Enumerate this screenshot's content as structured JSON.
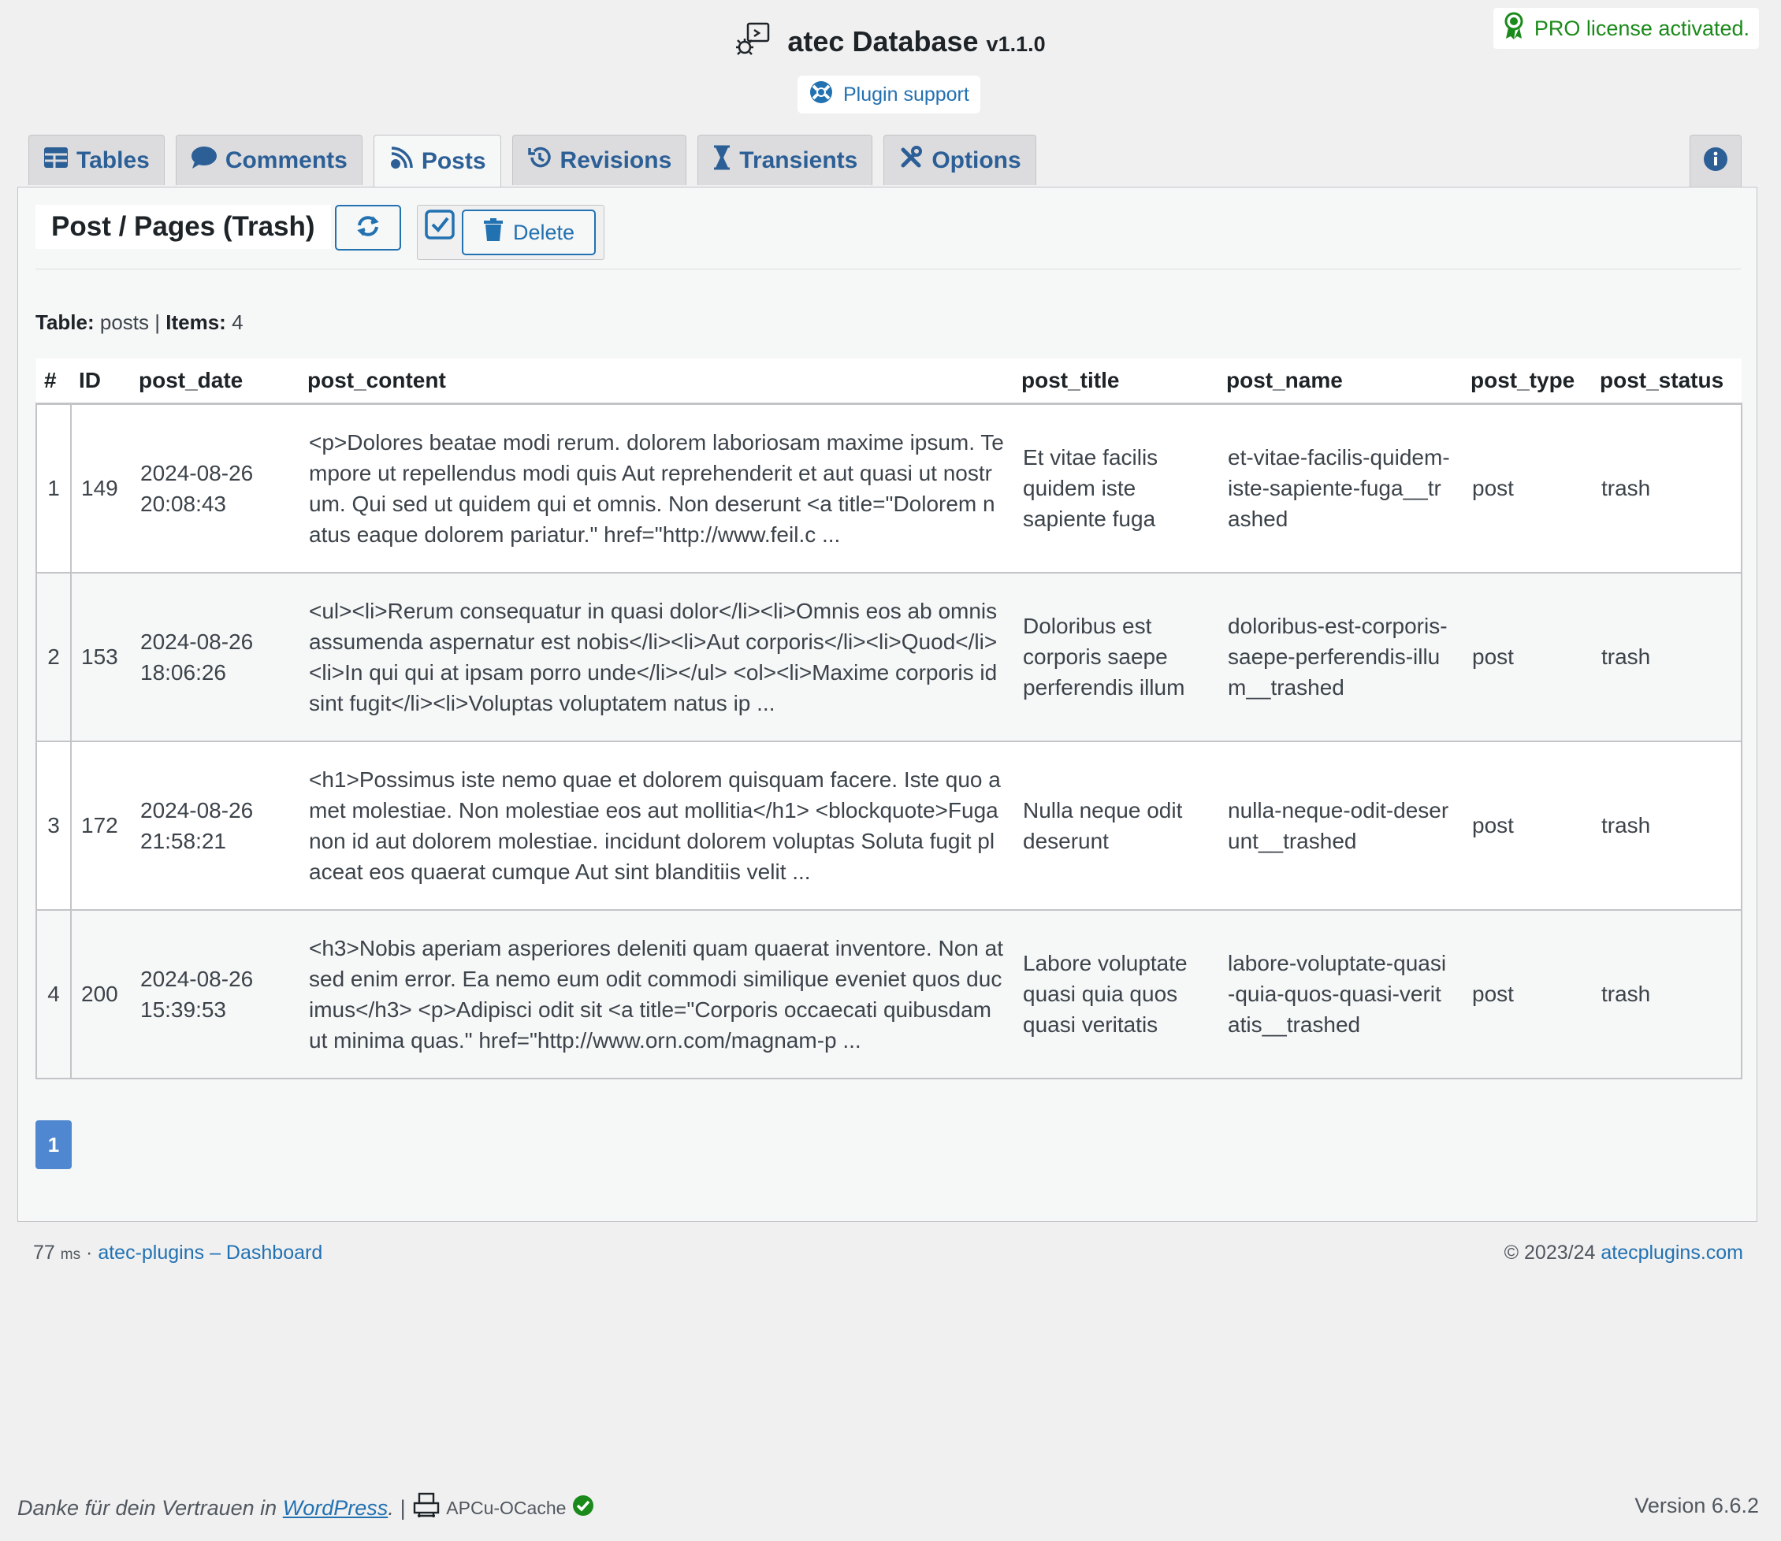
{
  "app": {
    "name": "atec Database",
    "version": "v1.1.0",
    "support_label": "Plugin support",
    "license_text": "PRO license activated."
  },
  "tabs": [
    {
      "label": "Tables",
      "icon": "table-icon",
      "active": false
    },
    {
      "label": "Comments",
      "icon": "comment-icon",
      "active": false
    },
    {
      "label": "Posts",
      "icon": "posts-icon",
      "active": true
    },
    {
      "label": "Revisions",
      "icon": "history-icon",
      "active": false
    },
    {
      "label": "Transients",
      "icon": "hourglass-icon",
      "active": false
    },
    {
      "label": "Options",
      "icon": "wrench-icon",
      "active": false
    }
  ],
  "section": {
    "title": "Post / Pages (Trash)",
    "delete_label": "Delete",
    "meta_table_label": "Table:",
    "meta_table_value": "posts",
    "meta_items_label": "Items:",
    "meta_items_value": "4"
  },
  "table": {
    "columns": [
      "#",
      "ID",
      "post_date",
      "post_content",
      "post_title",
      "post_name",
      "post_type",
      "post_status"
    ],
    "rows": [
      {
        "num": "1",
        "id": "149",
        "post_date": "2024-08-26 20:08:43",
        "post_content": "<p>Dolores beatae modi rerum. dolorem laboriosam maxime ipsum. Tempore ut repellendus modi quis Aut reprehenderit et aut quasi ut nostrum. Qui sed ut quidem qui et omnis. Non deserunt <a title=\"Dolorem natus eaque dolorem pariatur.\" href=\"http://www.feil.c ...",
        "post_title": "Et vitae facilis quidem iste sapiente fuga",
        "post_name": "et-vitae-facilis-quidem-iste-sapiente-fuga__trashed",
        "post_type": "post",
        "post_status": "trash"
      },
      {
        "num": "2",
        "id": "153",
        "post_date": "2024-08-26 18:06:26",
        "post_content": "<ul><li>Rerum consequatur in quasi dolor</li><li>Omnis eos ab omnis assumenda aspernatur est nobis</li><li>Aut corporis</li><li>Quod</li><li>In qui qui at ipsam porro unde</li></ul> <ol><li>Maxime corporis id sint fugit</li><li>Voluptas voluptatem natus ip ...",
        "post_title": "Doloribus est corporis saepe perferendis illum",
        "post_name": "doloribus-est-corporis-saepe-perferendis-illum__trashed",
        "post_type": "post",
        "post_status": "trash"
      },
      {
        "num": "3",
        "id": "172",
        "post_date": "2024-08-26 21:58:21",
        "post_content": "<h1>Possimus iste nemo quae et dolorem quisquam facere. Iste quo amet molestiae. Non molestiae eos aut mollitia</h1> <blockquote>Fuga non id aut dolorem molestiae. incidunt dolorem voluptas Soluta fugit placeat eos quaerat cumque Aut sint blanditiis velit ...",
        "post_title": "Nulla neque odit deserunt",
        "post_name": "nulla-neque-odit-deserunt__trashed",
        "post_type": "post",
        "post_status": "trash"
      },
      {
        "num": "4",
        "id": "200",
        "post_date": "2024-08-26 15:39:53",
        "post_content": "<h3>Nobis aperiam asperiores deleniti quam quaerat inventore. Non at sed enim error. Ea nemo eum odit commodi similique eveniet quos ducimus</h3> <p>Adipisci odit sit <a title=\"Corporis occaecati quibusdam ut minima quas.\" href=\"http://www.orn.com/magnam-p ...",
        "post_title": "Labore voluptate quasi quia quos quasi veritatis",
        "post_name": "labore-voluptate-quasi-quia-quos-quasi-veritatis__trashed",
        "post_type": "post",
        "post_status": "trash"
      }
    ]
  },
  "pagination": {
    "current": "1"
  },
  "plugin_footer": {
    "ms_value": "77",
    "ms_unit": "ms",
    "separator": "·",
    "dashboard_link": "atec-plugins – Dashboard",
    "copyright": "© 2023/24",
    "site_link": "atecplugins.com"
  },
  "wp_footer": {
    "thanks_text": "Danke für dein Vertrauen in",
    "wp_link": "WordPress",
    "suffix": ". |",
    "cache_label": "APCu-OCache",
    "version": "Version 6.6.2"
  },
  "colors": {
    "accent": "#2271b1",
    "tab_text": "#2c5f96",
    "success": "#1a8a1a",
    "page_active": "#4f87d1"
  }
}
